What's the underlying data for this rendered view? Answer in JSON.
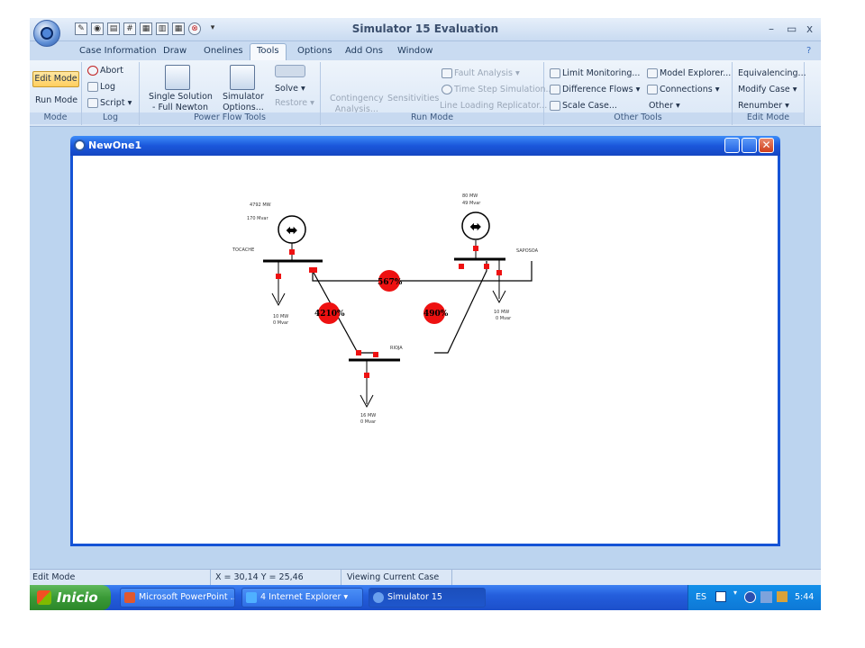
{
  "app": {
    "title": "Simulator 15 Evaluation",
    "minimize_glyph": "–",
    "restore_glyph": "▭",
    "close_glyph": "x"
  },
  "tabs": [
    {
      "label": "Case Information"
    },
    {
      "label": "Draw"
    },
    {
      "label": "Onelines"
    },
    {
      "label": "Tools",
      "active": true
    },
    {
      "label": "Options"
    },
    {
      "label": "Add Ons"
    },
    {
      "label": "Window"
    }
  ],
  "ribbon": {
    "mode": {
      "edit_mode": "Edit Mode",
      "run_mode": "Run Mode",
      "label": "Mode"
    },
    "log": {
      "abort": "Abort",
      "log": "Log",
      "script": "Script",
      "label": "Log"
    },
    "power_flow": {
      "single_solution_1": "Single Solution",
      "single_solution_2": "- Full Newton",
      "simulator_options_1": "Simulator",
      "simulator_options_2": "Options...",
      "solve": "Solve",
      "restore": "Restore",
      "label": "Power Flow Tools"
    },
    "run_mode": {
      "contingency_1": "Contingency",
      "contingency_2": "Analysis...",
      "sensitivities": "Sensitivities",
      "fault_analysis": "Fault Analysis",
      "time_step": "Time Step Simulation...",
      "line_loading": "Line Loading Replicator...",
      "label": "Run Mode"
    },
    "other_tools": {
      "limit_monitoring": "Limit Monitoring...",
      "difference_flows": "Difference Flows",
      "scale_case": "Scale Case...",
      "model_explorer": "Model Explorer...",
      "connections": "Connections",
      "other": "Other",
      "label": "Other Tools"
    },
    "edit_mode": {
      "equivalencing": "Equivalencing...",
      "modify_case": "Modify Case",
      "renumber": "Renumber",
      "label": "Edit Mode"
    }
  },
  "child_window": {
    "title": "NewOne1"
  },
  "oneline": {
    "buses": {
      "tocache": "TOCACHE",
      "saposoa": "SAPOSOA",
      "rioja": "RIOJA"
    },
    "gen_tocache": {
      "mw": "4792 MW",
      "mvar": "170 Mvar"
    },
    "gen_saposoa": {
      "mw": "80 MW",
      "mvar": "49 Mvar"
    },
    "load_tocache": {
      "mw": "10 MW",
      "mvar": "0 Mvar"
    },
    "load_saposoa": {
      "mw": "10 MW",
      "mvar": "0 Mvar"
    },
    "load_rioja": {
      "mw": "16 MW",
      "mvar": "0 Mvar"
    },
    "line_tocache_saposoa": "567%",
    "line_tocache_rioja": "4210%",
    "line_saposoa_rioja": "490%",
    "colors": {
      "overload": "#ee1111",
      "breaker": "#ee1111",
      "bus": "#000000"
    }
  },
  "statusbar": {
    "mode": "Edit Mode",
    "coords": "X = 30,14 Y = 25,46",
    "viewing": "Viewing Current Case"
  },
  "taskbar": {
    "start": "Inicio",
    "tasks": [
      {
        "label": "Microsoft PowerPoint ..."
      },
      {
        "label": "4 Internet Explorer"
      },
      {
        "label": "Simulator 15"
      }
    ],
    "lang": "ES",
    "time": "5:44"
  }
}
